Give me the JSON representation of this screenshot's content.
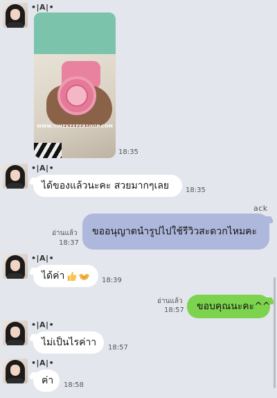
{
  "messages": [
    {
      "sender": "•|A|•",
      "type": "photo",
      "watermark": "WWW.TIMEKEEPERSHOP.COM",
      "time": "18:35"
    },
    {
      "sender": "•|A|•",
      "text": "ได้ของแล้วนะคะ สวยมากๆเลย",
      "time": "18:35"
    },
    {
      "sender": "ack",
      "text": "ขออนุญาตนำรูปไปใช้รีวิวสะดวกไหมคะ",
      "read": "อ่านแล้ว",
      "time": "18:37"
    },
    {
      "sender": "•|A|•",
      "text": "ได้ค่า",
      "time": "18:39"
    },
    {
      "text": "ขอบคุณนะคะ^^",
      "read": "อ่านแล้ว",
      "time": "18:57"
    },
    {
      "sender": "•|A|•",
      "text": "ไม่เป็นไรค่าา",
      "time": "18:57"
    },
    {
      "sender": "•|A|•",
      "text": "ค่า",
      "time": "18:58"
    }
  ],
  "colors": {
    "background": "#e3e6ec",
    "incoming_bubble": "#ffffff",
    "outgoing_review": "#aeb8dc",
    "outgoing_thanks": "#7dd34e"
  },
  "icons": [
    "thumbs-up-emoji",
    "handshake-emoji"
  ]
}
